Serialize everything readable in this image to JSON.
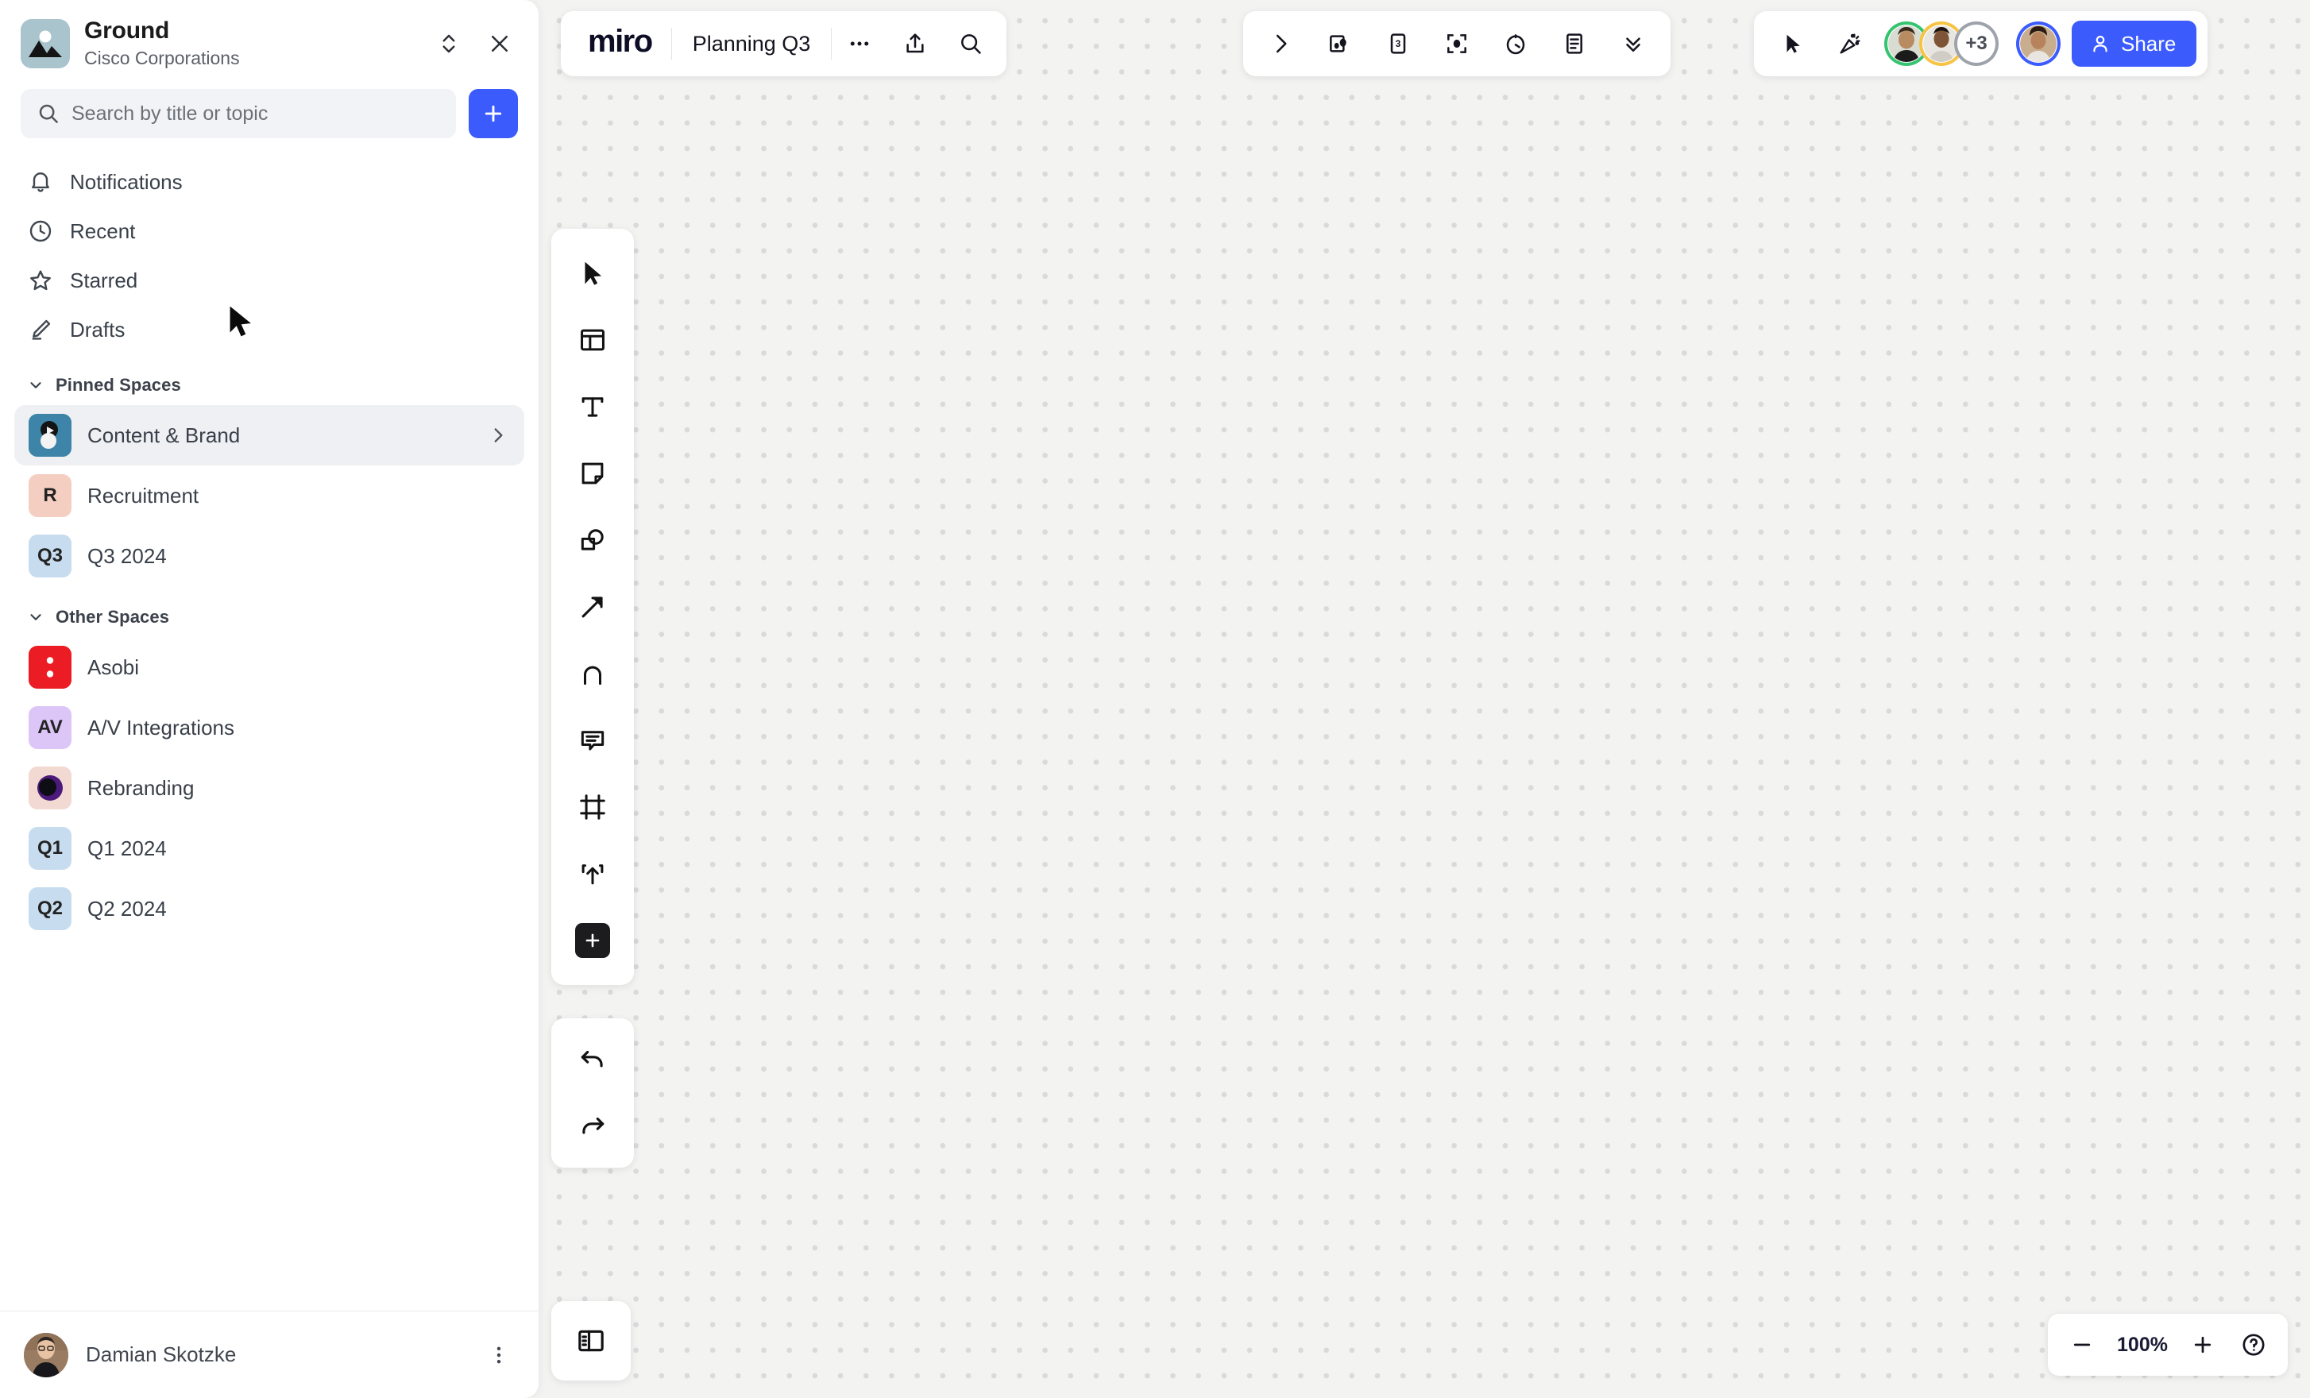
{
  "sidebar": {
    "workspace": {
      "name": "Ground",
      "org": "Cisco Corporations"
    },
    "header_actions": {
      "switcher_icon": "chevron-up-down-icon",
      "close_icon": "close-icon"
    },
    "search": {
      "placeholder": "Search by title or topic",
      "icon": "search-icon"
    },
    "create_button": {
      "icon": "plus-icon"
    },
    "nav": [
      {
        "label": "Notifications",
        "icon": "bell-icon"
      },
      {
        "label": "Recent",
        "icon": "clock-icon"
      },
      {
        "label": "Starred",
        "icon": "star-icon"
      },
      {
        "label": "Drafts",
        "icon": "pencil-icon"
      }
    ],
    "sections": [
      {
        "title": "Pinned Spaces",
        "items": [
          {
            "label": "Content & Brand",
            "avatar_type": "image",
            "avatar_bg": "#3d84a8",
            "active": true,
            "chevron": true
          },
          {
            "label": "Recruitment",
            "avatar_type": "initials",
            "initials": "R",
            "avatar_bg": "#f5cec2"
          },
          {
            "label": "Q3 2024",
            "avatar_type": "initials",
            "initials": "Q3",
            "avatar_bg": "#c7dcee"
          }
        ]
      },
      {
        "title": "Other Spaces",
        "items": [
          {
            "label": "Asobi",
            "avatar_type": "image",
            "avatar_bg": "#ec1c24"
          },
          {
            "label": "A/V Integrations",
            "avatar_type": "initials",
            "initials": "AV",
            "avatar_bg": "#dcc6f7"
          },
          {
            "label": "Rebranding",
            "avatar_type": "image",
            "avatar_bg": "#f2d9d2"
          },
          {
            "label": "Q1 2024",
            "avatar_type": "initials",
            "initials": "Q1",
            "avatar_bg": "#c7dcee"
          },
          {
            "label": "Q2 2024",
            "avatar_type": "initials",
            "initials": "Q2",
            "avatar_bg": "#c7dcee"
          }
        ]
      }
    ],
    "footer": {
      "user_name": "Damian Skotzke",
      "menu_icon": "kebab-menu-icon"
    }
  },
  "board_bar": {
    "logo": "miro",
    "board_name": "Planning Q3",
    "actions": [
      {
        "icon": "more-horizontal-icon"
      },
      {
        "icon": "share-export-icon"
      },
      {
        "icon": "search-icon"
      }
    ]
  },
  "tools_bar": {
    "items": [
      {
        "icon": "chevron-right-icon"
      },
      {
        "icon": "presentation-icon"
      },
      {
        "icon": "estimation-card-icon",
        "badge": "3"
      },
      {
        "icon": "spotlight-icon"
      },
      {
        "icon": "timer-icon"
      },
      {
        "icon": "notes-icon"
      },
      {
        "icon": "chevrons-down-icon"
      }
    ]
  },
  "right_bar": {
    "cursor_icon": "cursor-arrow-icon",
    "reactions_icon": "party-popper-icon",
    "collaborators": [
      {
        "ring_color": "#35c46f"
      },
      {
        "ring_color": "#f6c343"
      }
    ],
    "overflow_label": "+3",
    "overflow_ring_color": "#9ea3ab",
    "self_ring_color": "#3b5bfd",
    "share": {
      "label": "Share",
      "icon": "person-icon",
      "color": "#3b5bfd"
    }
  },
  "toolbar": {
    "tools": [
      {
        "icon": "select-cursor-icon"
      },
      {
        "icon": "templates-icon"
      },
      {
        "icon": "text-icon"
      },
      {
        "icon": "sticky-note-icon"
      },
      {
        "icon": "shapes-icon"
      },
      {
        "icon": "connector-arrow-icon"
      },
      {
        "icon": "pen-draw-icon"
      },
      {
        "icon": "comment-icon"
      },
      {
        "icon": "frame-icon"
      },
      {
        "icon": "upload-icon"
      },
      {
        "icon": "more-apps-plus-icon"
      }
    ],
    "history": [
      {
        "icon": "undo-icon"
      },
      {
        "icon": "redo-icon"
      }
    ],
    "panel_toggle_icon": "panel-toggle-icon"
  },
  "zoom_bar": {
    "zoom_out_icon": "minus-icon",
    "level": "100%",
    "zoom_in_icon": "plus-icon",
    "help_icon": "help-question-icon"
  },
  "colors": {
    "accent": "#3b5bfd",
    "canvas_bg": "#f3f3f2",
    "canvas_dot": "#dadada",
    "sidebar_bg": "#ffffff",
    "active_row": "#eff0f3"
  }
}
